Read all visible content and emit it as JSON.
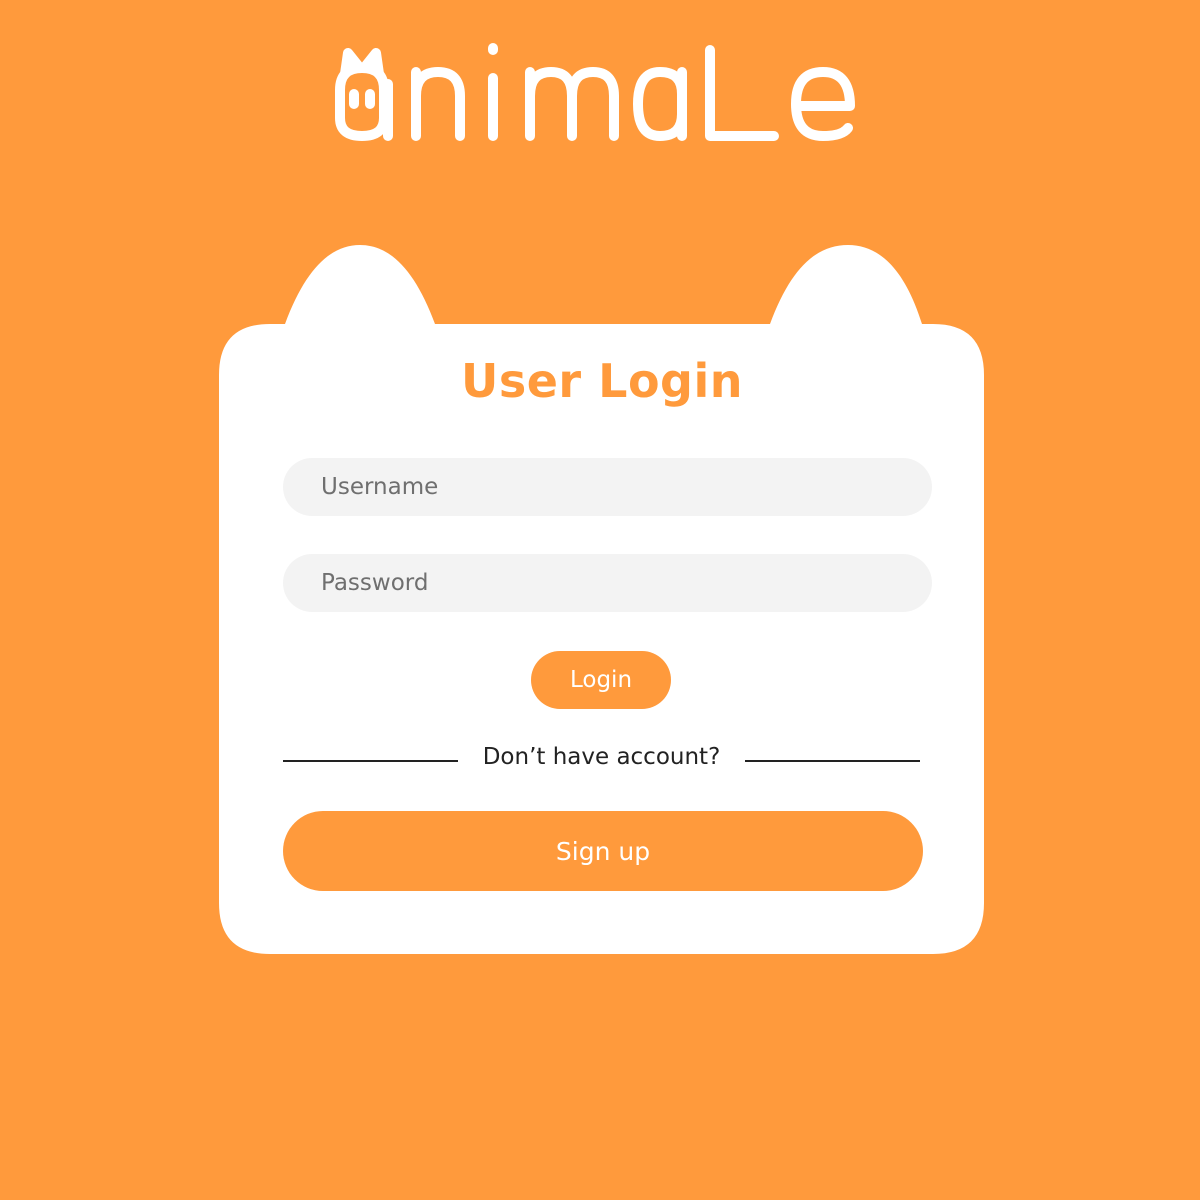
{
  "app": {
    "logo_text": "animaLe"
  },
  "login": {
    "title": "User Login",
    "username_placeholder": "Username",
    "password_placeholder": "Password",
    "login_label": "Login",
    "divider_text": "Don’t have account?",
    "signup_label": "Sign up"
  },
  "colors": {
    "background": "#FF9A3C",
    "card": "#FFFFFF",
    "accent": "#FF9A3C",
    "input_fill": "#F3F3F3",
    "text_dark": "#222222"
  },
  "icons": {
    "logo_mascot": "cat-face-icon"
  }
}
